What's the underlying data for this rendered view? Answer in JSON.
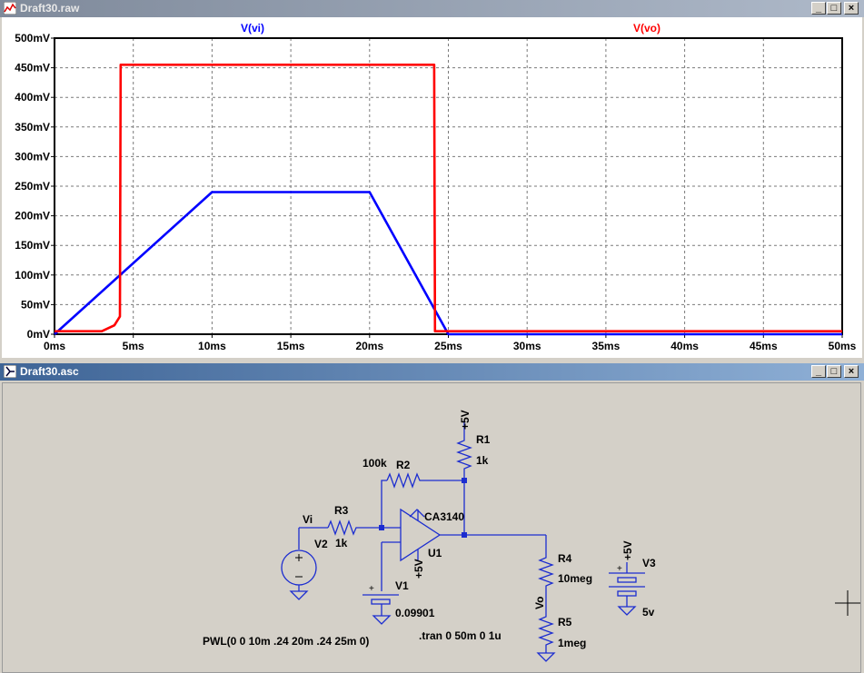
{
  "plot_window": {
    "title": "Draft30.raw",
    "controls": {
      "minimize": "_",
      "restore": "□",
      "close": "×"
    }
  },
  "schematic_window": {
    "title": "Draft30.asc",
    "controls": {
      "minimize": "_",
      "restore": "□",
      "close": "×"
    }
  },
  "chart_data": {
    "type": "line",
    "title": "",
    "xlabel": "",
    "ylabel": "",
    "xlim": [
      0,
      50
    ],
    "ylim": [
      0,
      500
    ],
    "grid": true,
    "x_ticks": [
      "0ms",
      "5ms",
      "10ms",
      "15ms",
      "20ms",
      "25ms",
      "30ms",
      "35ms",
      "40ms",
      "45ms",
      "50ms"
    ],
    "y_ticks": [
      "0mV",
      "50mV",
      "100mV",
      "150mV",
      "200mV",
      "250mV",
      "300mV",
      "350mV",
      "400mV",
      "450mV",
      "500mV"
    ],
    "series": [
      {
        "name": "V(vi)",
        "color": "#0000ff",
        "x": [
          0,
          10,
          20,
          25,
          50
        ],
        "y": [
          0,
          240,
          240,
          0,
          0
        ]
      },
      {
        "name": "V(vo)",
        "color": "#ff0000",
        "x": [
          0,
          3,
          3.8,
          4.15,
          4.2,
          24.1,
          24.15,
          50
        ],
        "y": [
          5,
          5,
          15,
          30,
          455,
          455,
          5,
          5
        ]
      }
    ]
  },
  "schematic": {
    "labels": {
      "plus5_r1": "+5V",
      "r1_name": "R1",
      "r1_value": "1k",
      "r2_value": "100k",
      "r2_name": "R2",
      "r3_name": "R3",
      "r3_value": "1k",
      "vi_net": "Vi",
      "v2_name": "V2",
      "opamp_model": "CA3140",
      "opamp_name": "U1",
      "opamp_supply": "+5V",
      "v1_name": "V1",
      "v1_value": "0.09901",
      "r4_name": "R4",
      "r4_value": "10meg",
      "vo_net": "Vo",
      "r5_name": "R5",
      "r5_value": "1meg",
      "plus5_v3": "+5V",
      "v3_name": "V3",
      "v3_value": "5v",
      "pwl_directive": "PWL(0 0 10m .24 20m .24 25m 0)",
      "tran_directive": ".tran 0 50m 0 1u"
    }
  }
}
